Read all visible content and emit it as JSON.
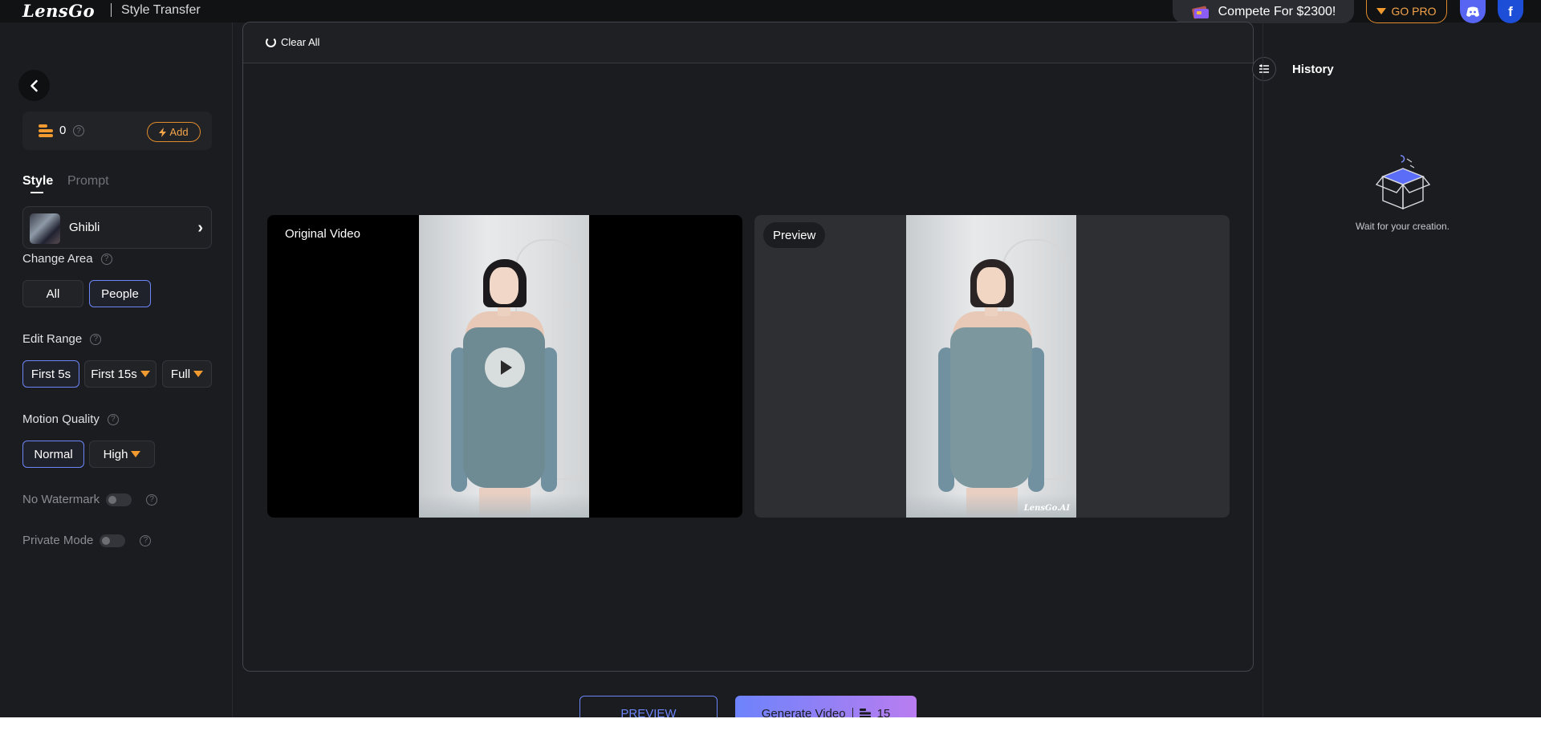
{
  "header": {
    "logo": "LensGo",
    "page_title": "Style Transfer",
    "compete_label": "Compete For $2300!",
    "gopro_label": "GO PRO",
    "facebook_letter": "f"
  },
  "sidebar": {
    "credits": "0",
    "add_label": "Add",
    "tabs": {
      "style": "Style",
      "prompt": "Prompt"
    },
    "selected_style": "Ghibli",
    "change_area": {
      "label": "Change Area",
      "options": [
        "All",
        "People"
      ],
      "selected": "People"
    },
    "edit_range": {
      "label": "Edit Range",
      "options": [
        "First 5s",
        "First 15s",
        "Full"
      ],
      "selected": "First 5s"
    },
    "motion_quality": {
      "label": "Motion Quality",
      "options": [
        "Normal",
        "High"
      ],
      "selected": "Normal"
    },
    "no_watermark": {
      "label": "No Watermark",
      "on": false
    },
    "private_mode": {
      "label": "Private Mode",
      "on": false
    }
  },
  "main": {
    "clear_all": "Clear All",
    "original_label": "Original Video",
    "preview_label": "Preview",
    "watermark": "LensGo.AI"
  },
  "history": {
    "title": "History",
    "empty_text": "Wait for your creation."
  },
  "actions": {
    "preview": "PREVIEW",
    "generate": "Generate Video",
    "generate_cost": "15"
  },
  "colors": {
    "accent_blue": "#6c86f7",
    "accent_orange": "#f19a30",
    "generate_gradient_start": "#6d83fb",
    "generate_gradient_end": "#b97df0"
  },
  "icons": [
    "back-arrow-icon",
    "coins-icon",
    "help-icon",
    "lightning-icon",
    "chevron-right-icon",
    "diamond-icon",
    "refresh-icon",
    "play-icon",
    "menu-icon",
    "empty-box-icon",
    "discord-icon",
    "facebook-icon"
  ]
}
